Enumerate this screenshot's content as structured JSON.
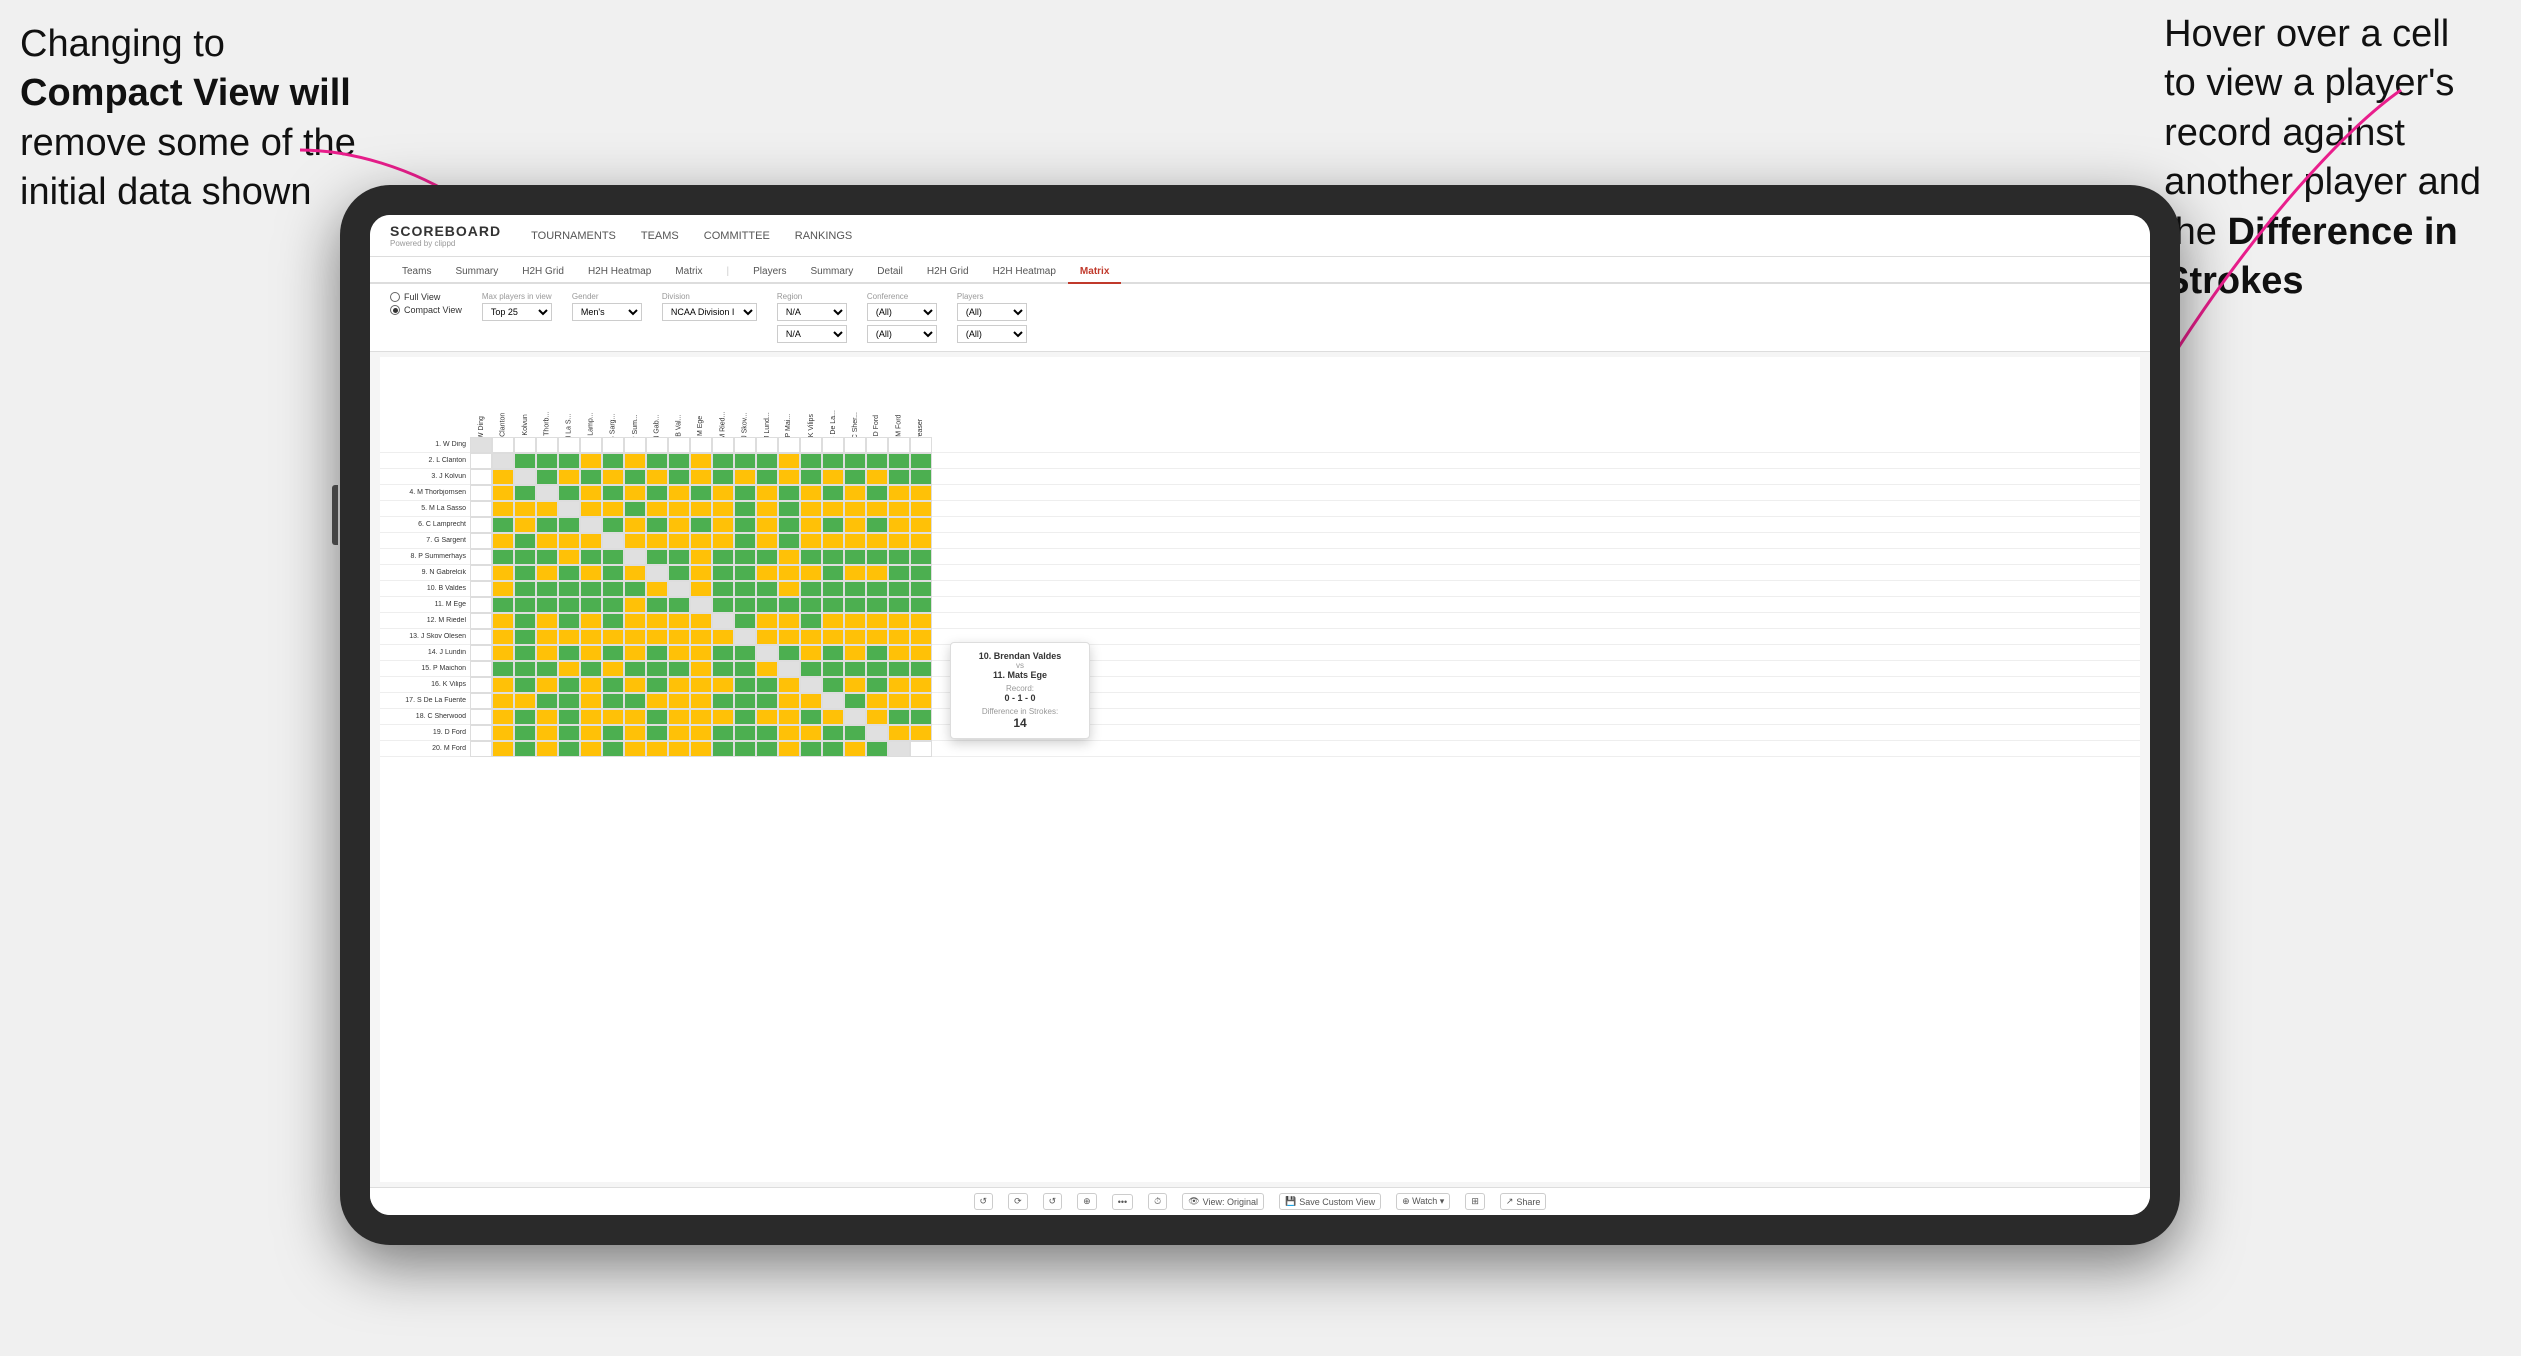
{
  "annotations": {
    "left": {
      "line1": "Changing to",
      "line2": "Compact View will",
      "line3": "remove some of the",
      "line4": "initial data shown"
    },
    "right": {
      "line1": "Hover over a cell",
      "line2": "to view a player's",
      "line3": "record against",
      "line4": "another player and",
      "line5": "the ",
      "line6": "Difference in",
      "line7": "Strokes"
    }
  },
  "app": {
    "logo": "SCOREBOARD",
    "logo_sub": "Powered by clippd",
    "nav_items": [
      "TOURNAMENTS",
      "TEAMS",
      "COMMITTEE",
      "RANKINGS"
    ]
  },
  "sub_tabs": [
    "Teams",
    "Summary",
    "H2H Grid",
    "H2H Heatmap",
    "Matrix",
    "Players",
    "Summary",
    "Detail",
    "H2H Grid",
    "H2H Heatmap",
    "Matrix"
  ],
  "active_tab": "Matrix",
  "controls": {
    "view_options": [
      "Full View",
      "Compact View"
    ],
    "selected_view": "Compact View",
    "filters": [
      {
        "label": "Max players in view",
        "value": "Top 25"
      },
      {
        "label": "Gender",
        "value": "Men's"
      },
      {
        "label": "Division",
        "value": "NCAA Division I"
      },
      {
        "label": "Region",
        "value": "N/A"
      },
      {
        "label": "Conference",
        "value": "(All)"
      },
      {
        "label": "Players",
        "value": "(All)"
      }
    ]
  },
  "players": [
    "1. W Ding",
    "2. L Clanton",
    "3. J Kolvun",
    "4. M Thorbjornsen",
    "5. M La Sasso",
    "6. C Lamprecht",
    "7. G Sargent",
    "8. P Summerhays",
    "9. N Gabrelcik",
    "10. B Valdes",
    "11. M Ege",
    "12. M Riedel",
    "13. J Skov Olesen",
    "14. J Lundin",
    "15. P Maichon",
    "16. K Vilips",
    "17. S De La Fuente",
    "18. C Sherwood",
    "19. D Ford",
    "20. M Ford"
  ],
  "col_headers": [
    "1. W Ding",
    "2. L Clanton",
    "3. J Kolvun",
    "4. M Thorb...",
    "5. M La S...",
    "6. C Lamp...",
    "7. G Sarg...",
    "8. P Sum...",
    "9. N Gab...",
    "10. B Val...",
    "11. M Ege",
    "12. M Ried...",
    "13. J Skov...",
    "14. J Lund...",
    "15. P Mai...",
    "16. K Vilips",
    "17. S De La...",
    "18. C Sher...",
    "19. D Ford",
    "20. M Ford",
    "..."
  ],
  "tooltip": {
    "player1": "10. Brendan Valdes",
    "vs": "vs",
    "player2": "11. Mats Ege",
    "record_label": "Record:",
    "record": "0 - 1 - 0",
    "diff_label": "Difference in Strokes:",
    "diff": "14"
  },
  "toolbar": {
    "undo": "↺",
    "redo": "↻",
    "view_original": "View: Original",
    "save_custom": "Save Custom View",
    "watch": "Watch",
    "share": "Share"
  }
}
